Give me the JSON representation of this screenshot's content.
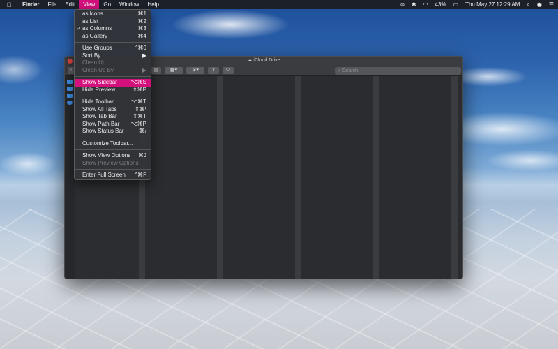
{
  "menubar": {
    "apple_icon": "apple-logo",
    "items": [
      "Finder",
      "File",
      "Edit",
      "View",
      "Go",
      "Window",
      "Help"
    ],
    "active_item": "View",
    "status": {
      "battery": "43%",
      "datetime": "Thu May 27  12:29 AM"
    }
  },
  "finder": {
    "title": "iCloud Drive",
    "search_placeholder": "Search"
  },
  "view_menu": {
    "group1": [
      {
        "label": "as Icons",
        "shortcut": "⌘1"
      },
      {
        "label": "as List",
        "shortcut": "⌘2"
      },
      {
        "label": "as Columns",
        "shortcut": "⌘3",
        "checked": true
      },
      {
        "label": "as Gallery",
        "shortcut": "⌘4"
      }
    ],
    "group2": [
      {
        "label": "Use Groups",
        "shortcut": "^⌘0"
      },
      {
        "label": "Sort By",
        "shortcut": "▶"
      },
      {
        "label": "Clean Up",
        "shortcut": ""
      },
      {
        "label": "Clean Up By",
        "shortcut": "▶"
      }
    ],
    "group3": [
      {
        "label": "Show Sidebar",
        "shortcut": "⌥⌘S",
        "highlighted": true
      },
      {
        "label": "Hide Preview",
        "shortcut": "⇧⌘P"
      }
    ],
    "group4": [
      {
        "label": "Hide Toolbar",
        "shortcut": "⌥⌘T"
      },
      {
        "label": "Show All Tabs",
        "shortcut": "⇧⌘\\"
      },
      {
        "label": "Show Tab Bar",
        "shortcut": "⇧⌘T"
      },
      {
        "label": "Show Path Bar",
        "shortcut": "⌥⌘P"
      },
      {
        "label": "Show Status Bar",
        "shortcut": "⌘/"
      }
    ],
    "group5": [
      {
        "label": "Customize Toolbar...",
        "shortcut": ""
      }
    ],
    "group6": [
      {
        "label": "Show View Options",
        "shortcut": "⌘J"
      },
      {
        "label": "Show Preview Options",
        "shortcut": ""
      }
    ],
    "group7": [
      {
        "label": "Enter Full Screen",
        "shortcut": "^⌘F"
      }
    ]
  },
  "colors": {
    "accent": "#d4107d",
    "menu_bg": "#323438",
    "window_bg": "#2b2d30"
  }
}
